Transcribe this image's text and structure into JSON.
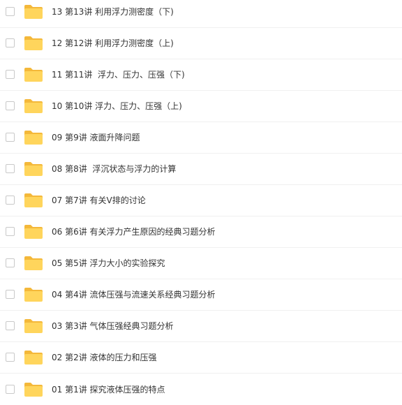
{
  "colors": {
    "folder_body": "#FFD55C",
    "folder_tab": "#F4B83A",
    "text": "#333333",
    "divider": "#F0F0F0",
    "checkbox_border": "#C9C9C9"
  },
  "files": [
    {
      "name": "13 第13讲 利用浮力测密度（下)",
      "icon": "folder-icon",
      "checked": false
    },
    {
      "name": "12 第12讲 利用浮力测密度（上)",
      "icon": "folder-icon",
      "checked": false
    },
    {
      "name": "11 第11讲  浮力、压力、压强（下)",
      "icon": "folder-icon",
      "checked": false
    },
    {
      "name": "10 第10讲 浮力、压力、压强（上)",
      "icon": "folder-icon",
      "checked": false
    },
    {
      "name": "09 第9讲 液面升降问题",
      "icon": "folder-icon",
      "checked": false
    },
    {
      "name": "08 第8讲  浮沉状态与浮力的计算",
      "icon": "folder-icon",
      "checked": false
    },
    {
      "name": "07 第7讲 有关V排的讨论",
      "icon": "folder-icon",
      "checked": false
    },
    {
      "name": "06 第6讲 有关浮力产生原因的经典习题分析",
      "icon": "folder-icon",
      "checked": false
    },
    {
      "name": "05 第5讲 浮力大小的实验探究",
      "icon": "folder-icon",
      "checked": false
    },
    {
      "name": "04 第4讲 流体压强与流速关系经典习题分析",
      "icon": "folder-icon",
      "checked": false
    },
    {
      "name": "03 第3讲 气体压强经典习题分析",
      "icon": "folder-icon",
      "checked": false
    },
    {
      "name": "02 第2讲 液体的压力和压强",
      "icon": "folder-icon",
      "checked": false
    },
    {
      "name": "01 第1讲 探究液体压强的特点",
      "icon": "folder-icon",
      "checked": false
    }
  ]
}
